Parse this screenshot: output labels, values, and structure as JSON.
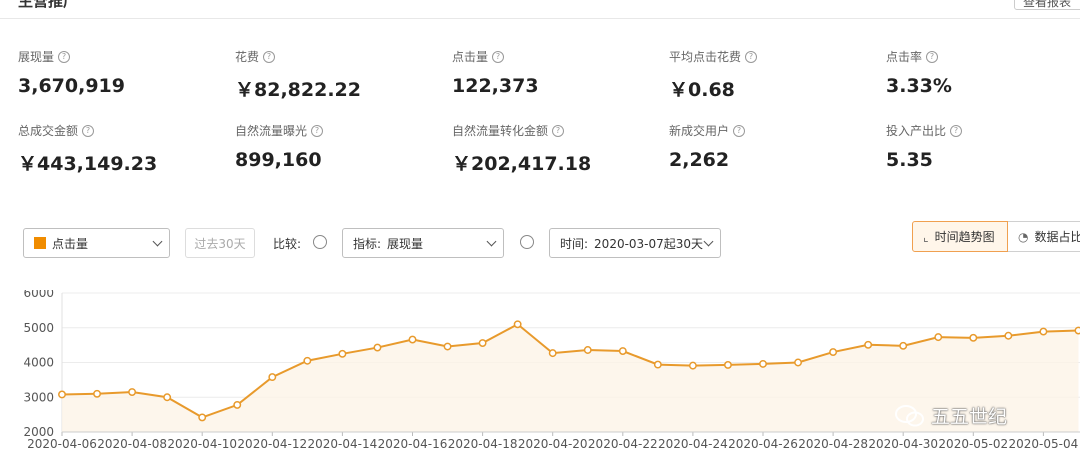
{
  "header": {
    "title": "主营推广",
    "corner_button": "查看报表"
  },
  "metrics": [
    {
      "label": "展现量",
      "value": "3,670,919"
    },
    {
      "label": "花费",
      "value": "￥82,822.22"
    },
    {
      "label": "点击量",
      "value": "122,373"
    },
    {
      "label": "平均点击花费",
      "value": "￥0.68"
    },
    {
      "label": "点击率",
      "value": "3.33%"
    },
    {
      "label": "总成交金额",
      "value": "￥443,149.23"
    },
    {
      "label": "自然流量曝光",
      "value": "899,160"
    },
    {
      "label": "自然流量转化金额",
      "value": "￥202,417.18"
    },
    {
      "label": "新成交用户",
      "value": "2,262"
    },
    {
      "label": "投入产出比",
      "value": "5.35"
    }
  ],
  "controls": {
    "metric_select": "点击量",
    "preset_range": "过去30天",
    "compare_label": "比较:",
    "indicator_label": "指标:",
    "indicator_value": "展现量",
    "time_label": "时间:",
    "time_value": "2020-03-07起30天",
    "view_trend": "时间趋势图",
    "view_share": "数据占比"
  },
  "watermark": "五五世纪",
  "colors": {
    "accent": "#f08c00",
    "line": "#e89a2c"
  },
  "chart_data": {
    "type": "area",
    "yticks": [
      2000,
      3000,
      4000,
      5000,
      6000
    ],
    "ylim": [
      2000,
      6000
    ],
    "xtick_labels": [
      "2020-04-06",
      "2020-04-08",
      "2020-04-10",
      "2020-04-12",
      "2020-04-14",
      "2020-04-16",
      "2020-04-18",
      "2020-04-20",
      "2020-04-22",
      "2020-04-24",
      "2020-04-26",
      "2020-04-28",
      "2020-04-30",
      "2020-05-02",
      "2020-05-04"
    ],
    "xtick_last_visible": "2020-0",
    "values": [
      3080,
      3100,
      3150,
      3000,
      2420,
      2780,
      3580,
      4050,
      4250,
      4430,
      4660,
      4460,
      4560,
      5100,
      4270,
      4360,
      4330,
      3940,
      3910,
      3930,
      3960,
      4000,
      4300,
      4510,
      4480,
      4730,
      4710,
      4770,
      4890,
      4920
    ],
    "grid": true
  }
}
